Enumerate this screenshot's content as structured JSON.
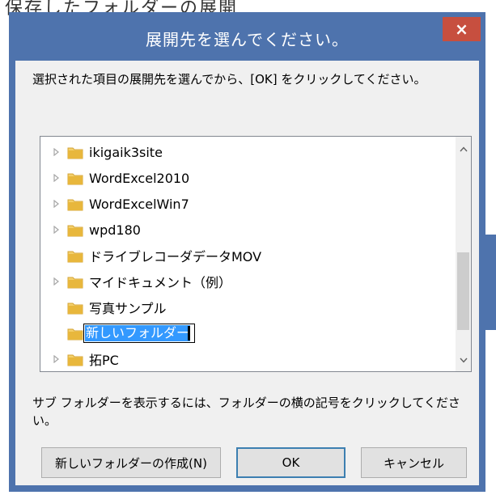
{
  "background": {
    "partial_title": "保存したフォルダーの展開"
  },
  "dialog": {
    "title": "展開先を選んでください。",
    "close_label": "×",
    "instruction": "選択された項目の展開先を選んでから、[OK] をクリックしてください。",
    "tree": {
      "items": [
        {
          "label": "ikigaik3site",
          "expander": true
        },
        {
          "label": "WordExcel2010",
          "expander": true
        },
        {
          "label": "WordExcelWin7",
          "expander": true
        },
        {
          "label": "wpd180",
          "expander": true
        },
        {
          "label": "ドライブレコーダデータMOV",
          "expander": false
        },
        {
          "label": "マイドキュメント（例）",
          "expander": true
        },
        {
          "label": "写真サンプル",
          "expander": false
        },
        {
          "label": "新しいフォルダー",
          "expander": false,
          "editing": true
        },
        {
          "label": "拓PC",
          "expander": true
        }
      ]
    },
    "hint": "サブ フォルダーを表示するには、フォルダーの横の記号をクリックしてください。",
    "buttons": {
      "new_folder": "新しいフォルダーの作成(N)",
      "ok": "OK",
      "cancel": "キャンセル"
    }
  },
  "colors": {
    "frame": "#4e73ad",
    "close": "#c74f3f",
    "selection": "#3399ff",
    "folder": "#e8b73c"
  },
  "icons": [
    "close-icon",
    "expand-arrow-icon",
    "folder-icon",
    "scroll-up-icon",
    "scroll-down-icon",
    "chevron-left-icon"
  ]
}
